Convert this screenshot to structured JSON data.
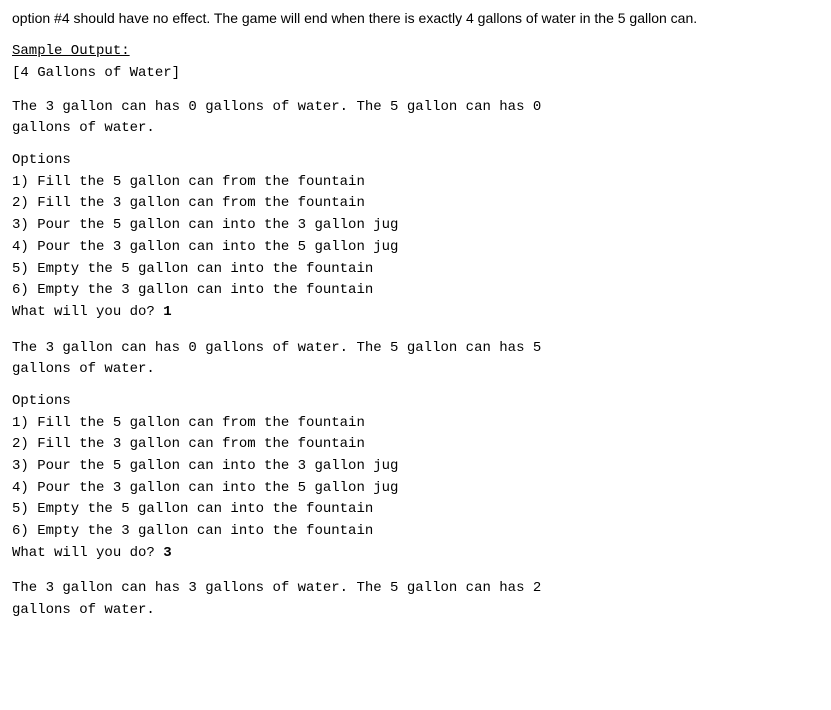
{
  "intro": {
    "text": "option #4 should have no effect. The game will end when there is exactly 4 gallons of water in the 5 gallon can."
  },
  "sample_output_label": "Sample Output:",
  "header_line": "[4 Gallons of Water]",
  "blocks": [
    {
      "state_line": "The 3 gallon can has 0 gallons of water. The 5 gallon can has 0",
      "state_line2": "gallons of water.",
      "options_label": "Options",
      "options": [
        "1) Fill the 5 gallon can from the fountain",
        "2) Fill the 3 gallon can from the fountain",
        "3) Pour the 5 gallon can into the 3 gallon jug",
        "4) Pour the 3 gallon can into the 5 gallon jug",
        "5) Empty the 5 gallon can into the fountain",
        "6) Empty the 3 gallon can into the fountain"
      ],
      "prompt": "What will you do? ",
      "choice": "1"
    },
    {
      "state_line": "The 3 gallon can has 0 gallons of water. The 5 gallon can has 5",
      "state_line2": "gallons of water.",
      "options_label": "Options",
      "options": [
        "1) Fill the 5 gallon can from the fountain",
        "2) Fill the 3 gallon can from the fountain",
        "3) Pour the 5 gallon can into the 3 gallon jug",
        "4) Pour the 3 gallon can into the 5 gallon jug",
        "5) Empty the 5 gallon can into the fountain",
        "6) Empty the 3 gallon can into the fountain"
      ],
      "prompt": "What will you do? ",
      "choice": "3"
    },
    {
      "state_line": "The 3 gallon can has 3 gallons of water. The 5 gallon can has 2",
      "state_line2": "gallons of water.",
      "options_label": null,
      "options": [],
      "prompt": "",
      "choice": ""
    }
  ]
}
